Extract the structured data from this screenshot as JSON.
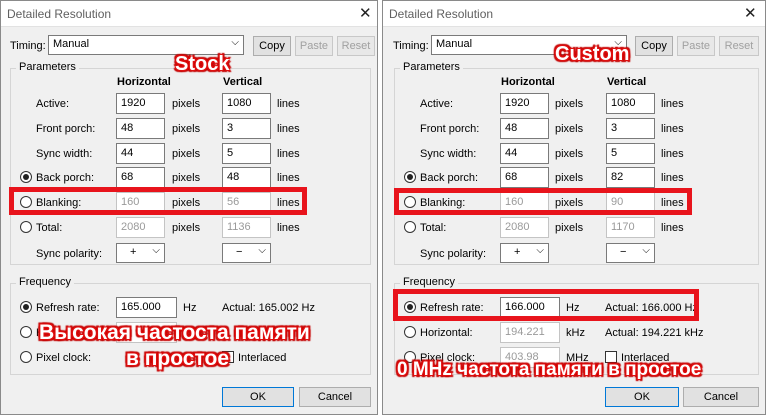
{
  "left": {
    "title": "Detailed Resolution",
    "timing_label": "Timing:",
    "timing_value": "Manual",
    "copy": "Copy",
    "paste": "Paste",
    "reset": "Reset",
    "params_title": "Parameters",
    "horizontal": "Horizontal",
    "vertical": "Vertical",
    "rows": [
      {
        "label": "Active:",
        "h": "1920",
        "hu": "pixels",
        "v": "1080",
        "vu": "lines"
      },
      {
        "label": "Front porch:",
        "h": "48",
        "hu": "pixels",
        "v": "3",
        "vu": "lines"
      },
      {
        "label": "Sync width:",
        "h": "44",
        "hu": "pixels",
        "v": "5",
        "vu": "lines"
      },
      {
        "label": "Back porch:",
        "h": "68",
        "hu": "pixels",
        "v": "48",
        "vu": "lines"
      },
      {
        "label": "Blanking:",
        "h": "160",
        "hu": "pixels",
        "v": "56",
        "vu": "lines"
      },
      {
        "label": "Total:",
        "h": "2080",
        "hu": "pixels",
        "v": "1136",
        "vu": "lines"
      }
    ],
    "sync_polarity_label": "Sync polarity:",
    "sync_h": "+",
    "sync_v": "−",
    "freq_title": "Frequency",
    "refresh_label": "Refresh rate:",
    "refresh_value": "165.000",
    "refresh_unit": "Hz",
    "refresh_actual": "Actual: 165.002 Hz",
    "horizontal_label": "Ho",
    "pixel_clock_label": "Pixel clock:",
    "interlaced": "Interlaced",
    "ok": "OK",
    "cancel": "Cancel",
    "annotation_stock": "Stock",
    "annotation_line1": "Высокая частоста памяти",
    "annotation_line2": "в простое"
  },
  "right": {
    "title": "Detailed Resolution",
    "timing_label": "Timing:",
    "timing_value": "Manual",
    "copy": "Copy",
    "paste": "Paste",
    "reset": "Reset",
    "params_title": "Parameters",
    "horizontal": "Horizontal",
    "vertical": "Vertical",
    "rows": [
      {
        "label": "Active:",
        "h": "1920",
        "hu": "pixels",
        "v": "1080",
        "vu": "lines"
      },
      {
        "label": "Front porch:",
        "h": "48",
        "hu": "pixels",
        "v": "3",
        "vu": "lines"
      },
      {
        "label": "Sync width:",
        "h": "44",
        "hu": "pixels",
        "v": "5",
        "vu": "lines"
      },
      {
        "label": "Back porch:",
        "h": "68",
        "hu": "pixels",
        "v": "82",
        "vu": "lines"
      },
      {
        "label": "Blanking:",
        "h": "160",
        "hu": "pixels",
        "v": "90",
        "vu": "lines"
      },
      {
        "label": "Total:",
        "h": "2080",
        "hu": "pixels",
        "v": "1170",
        "vu": "lines"
      }
    ],
    "sync_polarity_label": "Sync polarity:",
    "sync_h": "+",
    "sync_v": "−",
    "freq_title": "Frequency",
    "refresh_label": "Refresh rate:",
    "refresh_value": "166.000",
    "refresh_unit": "Hz",
    "refresh_actual": "Actual: 166.000 Hz",
    "horizontal_label": "Horizontal:",
    "horizontal_value": "194.221",
    "horizontal_unit": "kHz",
    "horizontal_actual": "Actual: 194.221 kHz",
    "pixel_clock_label": "Pixel clock:",
    "pixel_clock_value": "403.98",
    "pixel_clock_unit": "MHz",
    "interlaced": "Interlaced",
    "ok": "OK",
    "cancel": "Cancel",
    "annotation_custom": "Custom",
    "annotation_line": "0 MHz частота памяти в простое"
  }
}
